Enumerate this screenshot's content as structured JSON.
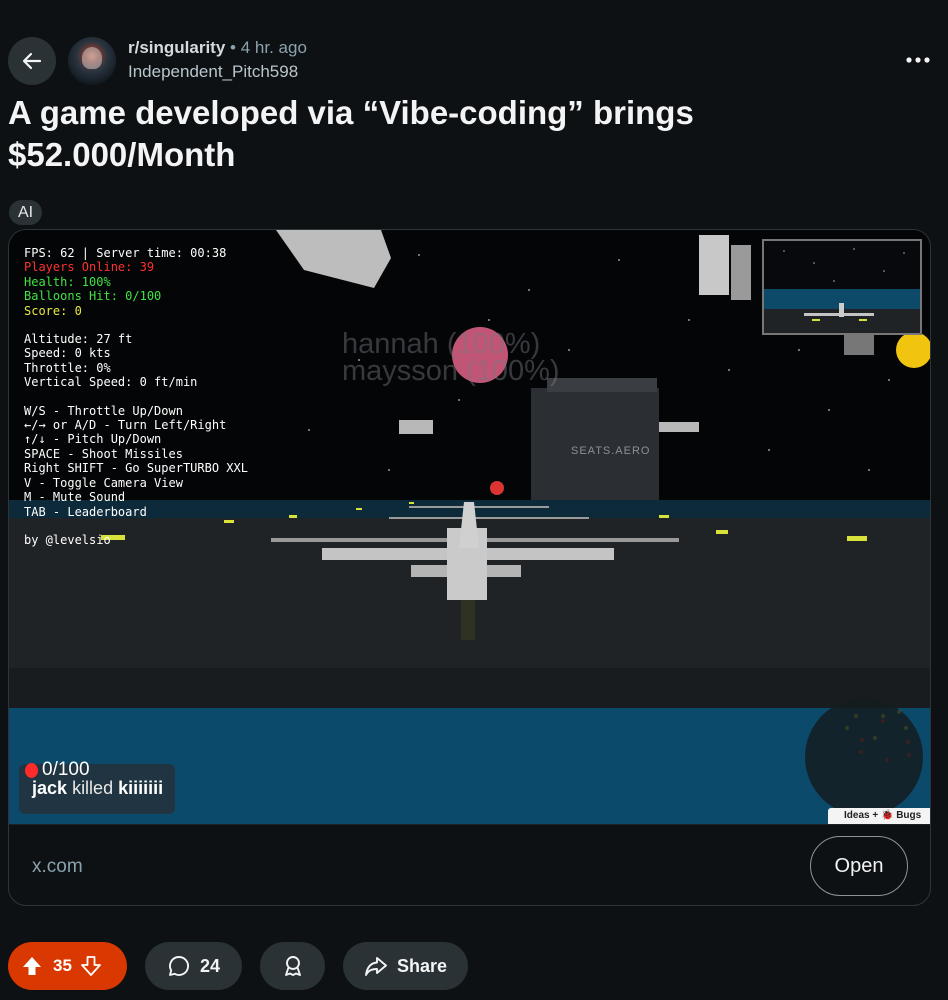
{
  "post": {
    "subreddit": "r/singularity",
    "time_ago": "4 hr. ago",
    "author": "Independent_Pitch598",
    "title": "A game developed via “Vibe-coding” brings $52.000/Month",
    "flair": "AI"
  },
  "game": {
    "hud": {
      "fps": "FPS: 62 | Server time: 00:38",
      "players": "Players Online: 39",
      "health": "Health: 100%",
      "balloons": "Balloons Hit: 0/100",
      "score": "Score: 0",
      "altitude": "Altitude: 27 ft",
      "speed": "Speed: 0 kts",
      "throttle": "Throttle: 0%",
      "vspeed": "Vertical Speed: 0 ft/min",
      "controls": [
        "W/S - Throttle Up/Down",
        "←/→ or A/D - Turn Left/Right",
        "↑/↓ - Pitch Up/Down",
        "SPACE - Shoot Missiles",
        "Right SHIFT - Go SuperTURBO XXL",
        "V - Toggle Camera View",
        "M - Mute Sound",
        "TAB - Leaderboard"
      ],
      "credit": "by @levelsio"
    },
    "overlay_names": [
      "hannah (100%)",
      "maysson (100%)"
    ],
    "building_label": "SEATS.AERO",
    "balloon_counter": "0/100",
    "kill_feed": {
      "killer": "jack",
      "verb": "killed",
      "victim": "kiiiiiii"
    },
    "ideas_label": "Ideas + 🐞 Bugs"
  },
  "link": {
    "domain": "x.com",
    "open_label": "Open"
  },
  "actions": {
    "score": "35",
    "comments": "24",
    "share_label": "Share"
  },
  "colors": {
    "background": "#0e1113",
    "vote_accent": "#d93900",
    "pill": "#2a3236"
  }
}
